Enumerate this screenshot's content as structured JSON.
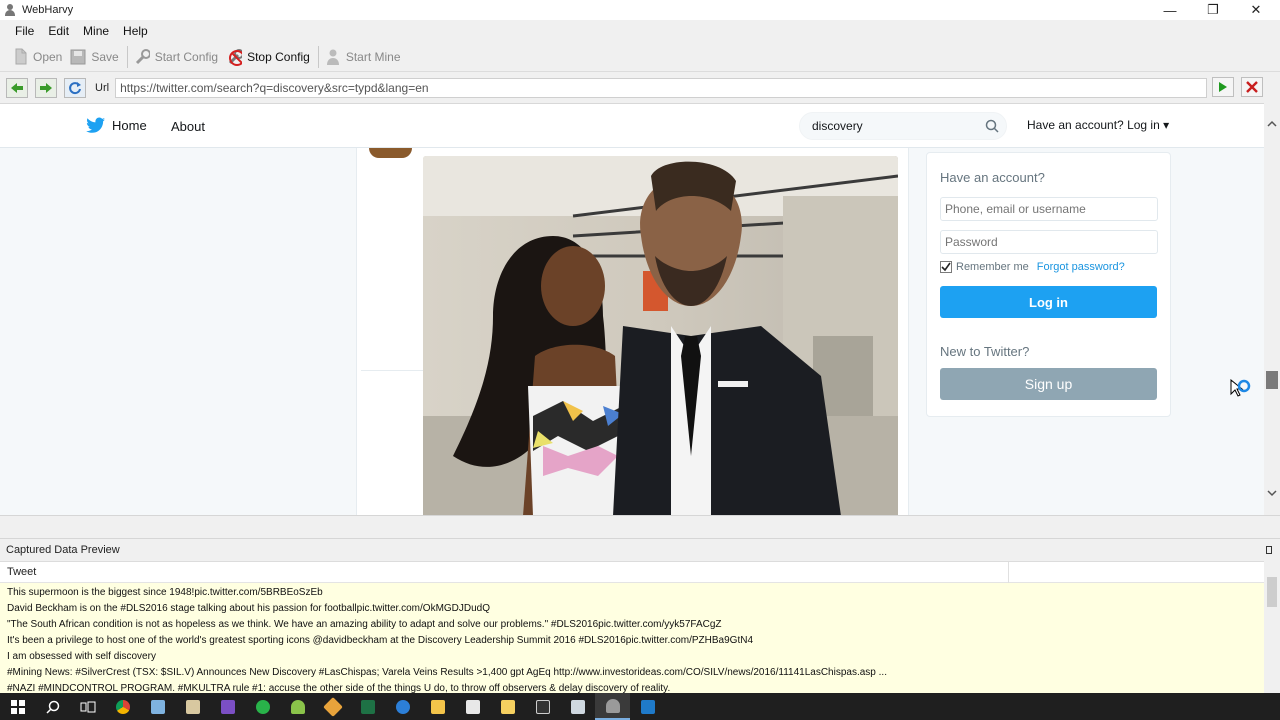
{
  "window": {
    "title": "WebHarvy",
    "controls": {
      "minimize": "—",
      "restore": "❐",
      "close": "✕"
    }
  },
  "menu": [
    "File",
    "Edit",
    "Mine",
    "Help"
  ],
  "toolbar": {
    "open": "Open",
    "save": "Save",
    "start_config": "Start Config",
    "stop_config": "Stop Config",
    "start_mine": "Start Mine"
  },
  "urlbar": {
    "label": "Url",
    "value": "https://twitter.com/search?q=discovery&src=typd&lang=en"
  },
  "twitter": {
    "nav": {
      "home": "Home",
      "about": "About",
      "search_value": "discovery",
      "login_link": "Have an account? Log in ▾"
    },
    "login_card": {
      "heading": "Have an account?",
      "username_placeholder": "Phone, email or username",
      "password_placeholder": "Password",
      "remember_me": "Remember me",
      "remember_me_checked": true,
      "forgot_password": "Forgot password?",
      "login_button": "Log in",
      "new_to": "New to Twitter?",
      "signup_button": "Sign up"
    },
    "colors": {
      "brand": "#1da1f2",
      "signup": "#8fa6b3"
    }
  },
  "preview": {
    "title": "Captured Data Preview",
    "column": "Tweet",
    "rows": [
      "This supermoon is the biggest since 1948!pic.twitter.com/5BRBEoSzEb",
      "David Beckham is on the #DLS2016 stage talking about his passion for footballpic.twitter.com/OkMGDJDudQ",
      "\"The South African condition is not as hopeless as we think. We have an amazing ability to adapt and solve our problems.\" #DLS2016pic.twitter.com/yyk57FACgZ",
      "It's been a privilege to host one of the world's greatest sporting icons @davidbeckham at the Discovery Leadership Summit 2016 #DLS2016pic.twitter.com/PZHBa9GtN4",
      "I am obsessed with self discovery",
      "#Mining News: #SilverCrest (TSX: $SIL.V) Announces New Discovery #LasChispas; Varela Veins Results >1,400 gpt AgEq http://www.investorideas.com/CO/SILV/news/2016/11141LasChispas.asp ...",
      "#NAZI #MINDCONTROL PROGRAM. #MKULTRA rule #1: accuse the other side of the things U do, to throw off observers & delay discovery of reality."
    ]
  },
  "taskbar": {
    "items": [
      "windows-start",
      "search",
      "task-view",
      "chrome",
      "app-2",
      "app-3",
      "visual-studio",
      "sync",
      "android",
      "app-8",
      "excel",
      "edge",
      "file-explorer",
      "store",
      "app-13",
      "terminal",
      "app-15",
      "webharvy",
      "app-17"
    ]
  }
}
